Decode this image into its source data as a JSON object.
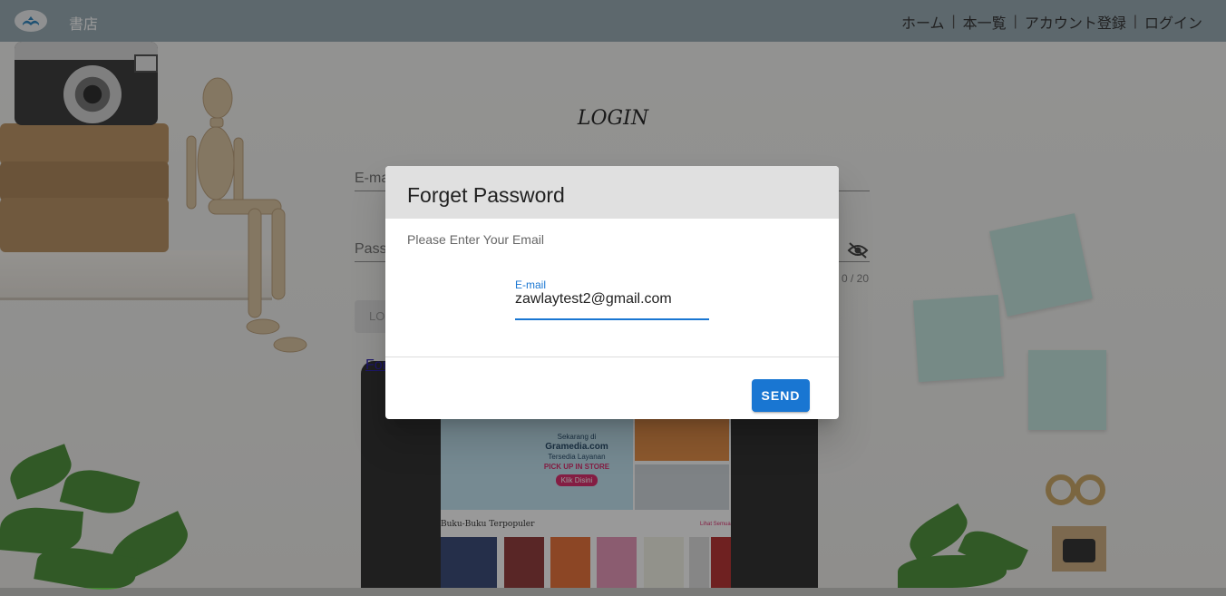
{
  "header": {
    "brand": "書店",
    "nav": [
      {
        "label": "ホーム"
      },
      {
        "label": "本一覧"
      },
      {
        "label": "アカウント登録"
      },
      {
        "label": "ログイン"
      }
    ],
    "separator": "|"
  },
  "login": {
    "title": "LOGIN",
    "email_label_partial": "E-ma",
    "password_label_partial": "Pass",
    "counter": "0 / 20",
    "login_button_partial": "LO",
    "forgot_link_partial": "For"
  },
  "dialog": {
    "title": "Forget Password",
    "subtitle": "Please Enter Your Email",
    "email_label": "E-mail",
    "email_value": "zawlaytest2@gmail.com",
    "send_label": "SEND"
  },
  "background_screen": {
    "banner_line1": "Sekarang di",
    "banner_line2": "Gramedia.com",
    "banner_line3": "Tersedia Layanan",
    "banner_highlight": "PICK UP IN STORE",
    "banner_button": "Klik Disini",
    "section_title": "Buku-Buku Terpopuler",
    "see_all": "Lihat Semua"
  },
  "colors": {
    "header_bg": "#90a4ae",
    "primary": "#1976d2",
    "dialog_head_bg": "#e0e0e0"
  }
}
